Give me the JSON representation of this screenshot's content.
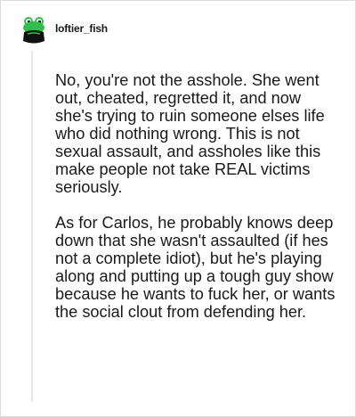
{
  "comment": {
    "username": "loftier_fish",
    "avatar_icon": "frog-avatar-icon",
    "paragraphs": [
      "No, you're not the asshole. She went out, cheated, regretted it, and now she's trying to ruin someone elses life who did nothing wrong. This is not sexual assault, and assholes like this make people not take REAL victims seriously.",
      "As for Carlos, he probably knows deep down that she wasn't assaulted (if hes not a complete idiot), but he's playing along and putting up a tough guy show because he wants to fuck her, or wants the social clout from defending her."
    ]
  },
  "colors": {
    "text": "#1a1a1b",
    "thread_line": "#e6e6e6",
    "avatar_green": "#2fbf4a",
    "avatar_dark": "#111111"
  }
}
